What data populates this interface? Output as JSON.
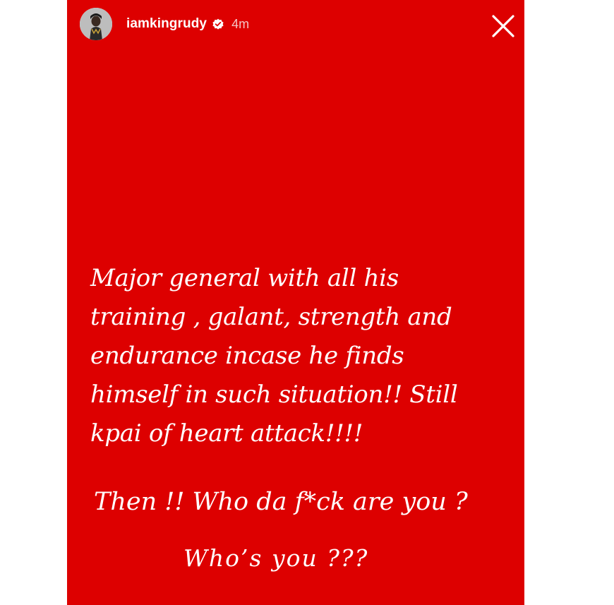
{
  "story": {
    "background_color": "#dd0000",
    "header": {
      "username": "iamkingrudy",
      "verified": true,
      "time_ago": "4m",
      "avatar_icon": "profile-photo",
      "close_icon": "close-x-icon"
    },
    "text_lines": [
      "Major general with all his",
      "training , galant, strength and",
      "endurance incase he finds",
      "himself in such situation!! Still",
      "kpai of heart attack!!!!"
    ],
    "question_line": "Then !! Who da f*ck are you ?",
    "final_line": "Who’s you ???"
  }
}
